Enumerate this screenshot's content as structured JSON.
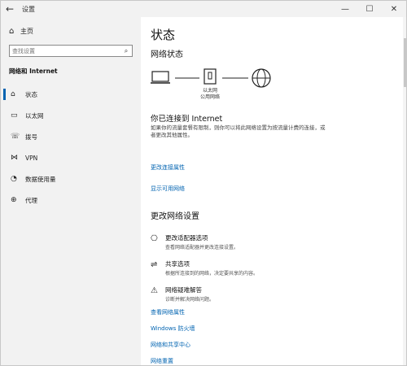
{
  "window": {
    "title": "设置"
  },
  "sidebar": {
    "home_label": "主页",
    "search_placeholder": "查找设置",
    "section_title": "网络和 Internet",
    "items": [
      {
        "label": "状态",
        "icon": "home-icon"
      },
      {
        "label": "以太网",
        "icon": "ethernet-icon"
      },
      {
        "label": "拨号",
        "icon": "phone-icon"
      },
      {
        "label": "VPN",
        "icon": "vpn-icon"
      },
      {
        "label": "数据使用量",
        "icon": "data-usage-icon"
      },
      {
        "label": "代理",
        "icon": "globe-icon"
      }
    ]
  },
  "main": {
    "title": "状态",
    "network_status_heading": "网络状态",
    "diagram_label_line1": "以太网",
    "diagram_label_line2": "公用网络",
    "connected_title": "你已连接到 Internet",
    "connected_desc": "如果你的流量套餐有限制，则你可以将此网络设置为按流量计费的连接，或者更改其他属性。",
    "link_change_props": "更改连接属性",
    "link_show_networks": "显示可用网络",
    "change_settings_heading": "更改网络设置",
    "options": [
      {
        "title": "更改适配器选项",
        "desc": "查看网络适配器并更改连接设置。"
      },
      {
        "title": "共享选项",
        "desc": "根据所连接到的网络，决定要共享的内容。"
      },
      {
        "title": "网络疑难解答",
        "desc": "诊断并解决网络问题。"
      }
    ],
    "links": [
      "查看网络属性",
      "Windows 防火墙",
      "网络和共享中心",
      "网络重置"
    ]
  },
  "colors": {
    "accent": "#0063b1",
    "sidebar_bg": "#f2f2f2"
  }
}
